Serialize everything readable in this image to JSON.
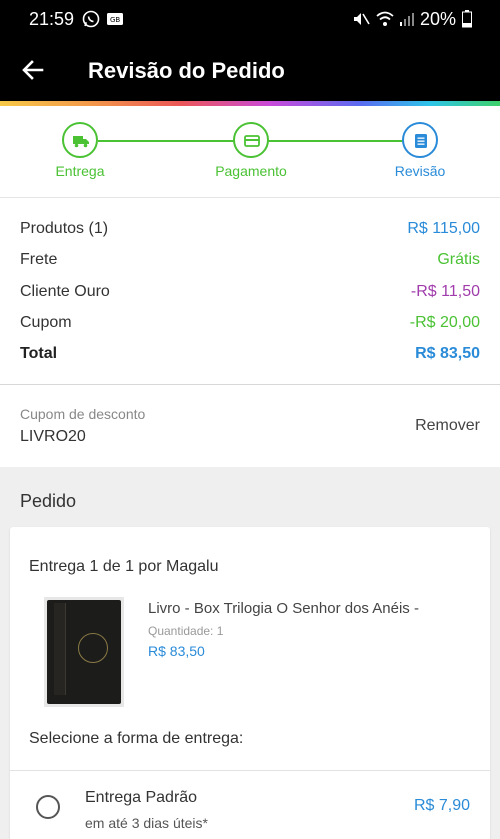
{
  "status_bar": {
    "time": "21:59",
    "battery": "20%",
    "icons": [
      "whatsapp-icon",
      "cast-icon",
      "mute-icon",
      "wifi-icon",
      "signal-icon",
      "battery-icon"
    ]
  },
  "app_bar": {
    "title": "Revisão do Pedido",
    "back_icon": "arrow-left-icon"
  },
  "stepper": {
    "steps": [
      {
        "label": "Entrega",
        "icon": "truck-icon",
        "state": "done"
      },
      {
        "label": "Pagamento",
        "icon": "card-icon",
        "state": "done"
      },
      {
        "label": "Revisão",
        "icon": "document-icon",
        "state": "active"
      }
    ],
    "colors": {
      "done": "#4ac234",
      "active": "#2a8bd8"
    }
  },
  "summary": {
    "rows": [
      {
        "label": "Produtos (1)",
        "value": "R$ 115,00",
        "color": "#2a8bd8"
      },
      {
        "label": "Frete",
        "value": "Grátis",
        "color": "#4ac234"
      },
      {
        "label": "Cliente Ouro",
        "value": "-R$ 11,50",
        "color": "#a03cab"
      },
      {
        "label": "Cupom",
        "value": "-R$ 20,00",
        "color": "#4ac234"
      },
      {
        "label": "Total",
        "value": "R$ 83,50",
        "color": "#2a8bd8"
      }
    ]
  },
  "coupon": {
    "label": "Cupom de desconto",
    "code": "LIVRO20",
    "remove_label": "Remover"
  },
  "order": {
    "title": "Pedido",
    "shipment_title": "Entrega 1 de 1 por Magalu",
    "product": {
      "name": "Livro - Box Trilogia O Senhor dos Anéis -",
      "quantity_label": "Quantidade:  1",
      "price": "R$ 83,50"
    },
    "select_delivery_label": "Selecione a forma de entrega:",
    "delivery_option": {
      "name": "Entrega Padrão",
      "subtitle": "em até 3 dias úteis*",
      "price": "R$ 7,90"
    }
  }
}
